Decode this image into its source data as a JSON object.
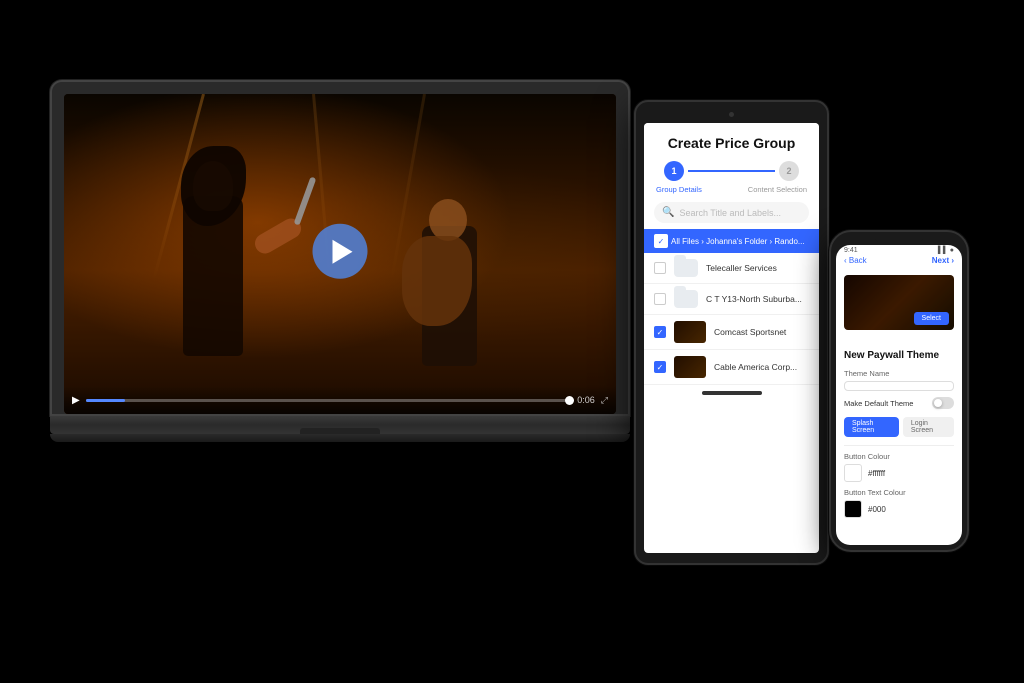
{
  "scene": {
    "bg": "#000"
  },
  "laptop": {
    "video": {
      "play_button_visible": true,
      "time": "0:06",
      "progress_percent": 8
    },
    "controls": {
      "play_icon": "▶",
      "time_label": "0:06",
      "close_icon": "✕"
    }
  },
  "tablet": {
    "title": "Create Price Group",
    "step1_label": "Group Details",
    "step2_label": "Content Selection",
    "step1_number": "1",
    "step2_number": "2",
    "search_placeholder": "Search Title and Labels...",
    "breadcrumb": "All Files › Johanna's Folder › Rando...",
    "rows": [
      {
        "type": "folder",
        "checked": false,
        "label": "Telecaller Services"
      },
      {
        "type": "folder",
        "checked": false,
        "label": "C T Y13-North Suburba..."
      },
      {
        "type": "video",
        "checked": true,
        "label": "Comcast Sportsnet"
      },
      {
        "type": "video",
        "checked": true,
        "label": "Cable America Corp..."
      }
    ]
  },
  "phone": {
    "status_left": "9:41",
    "status_right": "▌▌▌ WiFi 🔋",
    "back_label": "‹ Back",
    "next_label": "Next ›",
    "section_title": "New Paywall Theme",
    "fields": {
      "theme_name_label": "Theme Name",
      "theme_name_placeholder": "",
      "make_default_label": "Make Default Theme",
      "button_color_label": "Button Colour",
      "button_color_value": "#ffffff",
      "button_text_color_label": "Button Text Colour",
      "button_text_color_value": "#000"
    },
    "tabs": {
      "splash_label": "Splash Screen",
      "login_label": "Login Screen"
    }
  }
}
